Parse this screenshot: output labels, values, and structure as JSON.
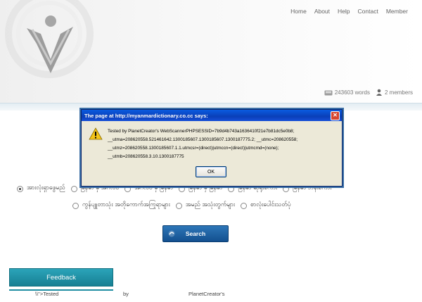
{
  "nav": {
    "items": [
      "Home",
      "About",
      "Help",
      "Contact",
      "Member"
    ]
  },
  "stats": {
    "words": "243603 words",
    "members": "2 members"
  },
  "dialog": {
    "title": "The page at http://myanmardictionary.co.cc says:",
    "lines": [
      "Tested by PlanetCreator's WebScannerPHPSESSID=7b9d4b743a1636410f21e7b81dc5e0b8;",
      "__utma=208620558.521461642.1300185607.1300185607.1300187775.2; __utmc=208620558;",
      "__utmz=208620558.1300185607.1.1.utmcsr=(direct)|utmccn=(direct)|utmcmd=(none);",
      "__utmb=208620558.3.10.1300187775"
    ],
    "ok_label": "OK"
  },
  "search": {
    "options_row1": [
      "အားလုံးရှာဖွေမည်",
      "မြန်မာ မှ အင်္ဂလိပ်",
      "အင်္ဂလိပ် မှ မြန်မာ",
      "မြန်မာ မှ မြန်မာ",
      "မြန်မာ ဆိုရိုးစကား",
      "မြန်မာ ဘန်းစကား"
    ],
    "options_row2": [
      "ကွန်ပျူတာသုံး အတိုကောက်အကြုရာများ",
      "အမည် အသုံးတွက်များ",
      "စာလုံးပေါင်းသတ်ပုံ"
    ],
    "selected": "အားလုံးရှာဖွေမည်",
    "button_label": "Search"
  },
  "feedback": {
    "label": "Feedback"
  },
  "footer_text": {
    "a": "\\\\\">Tested",
    "b": "by",
    "c": "PlanetCreator's"
  },
  "colors": {
    "search_button": "#1a5d9f",
    "feedback_tab": "#2196ac",
    "dialog_titlebar": "#0a4fd0"
  }
}
